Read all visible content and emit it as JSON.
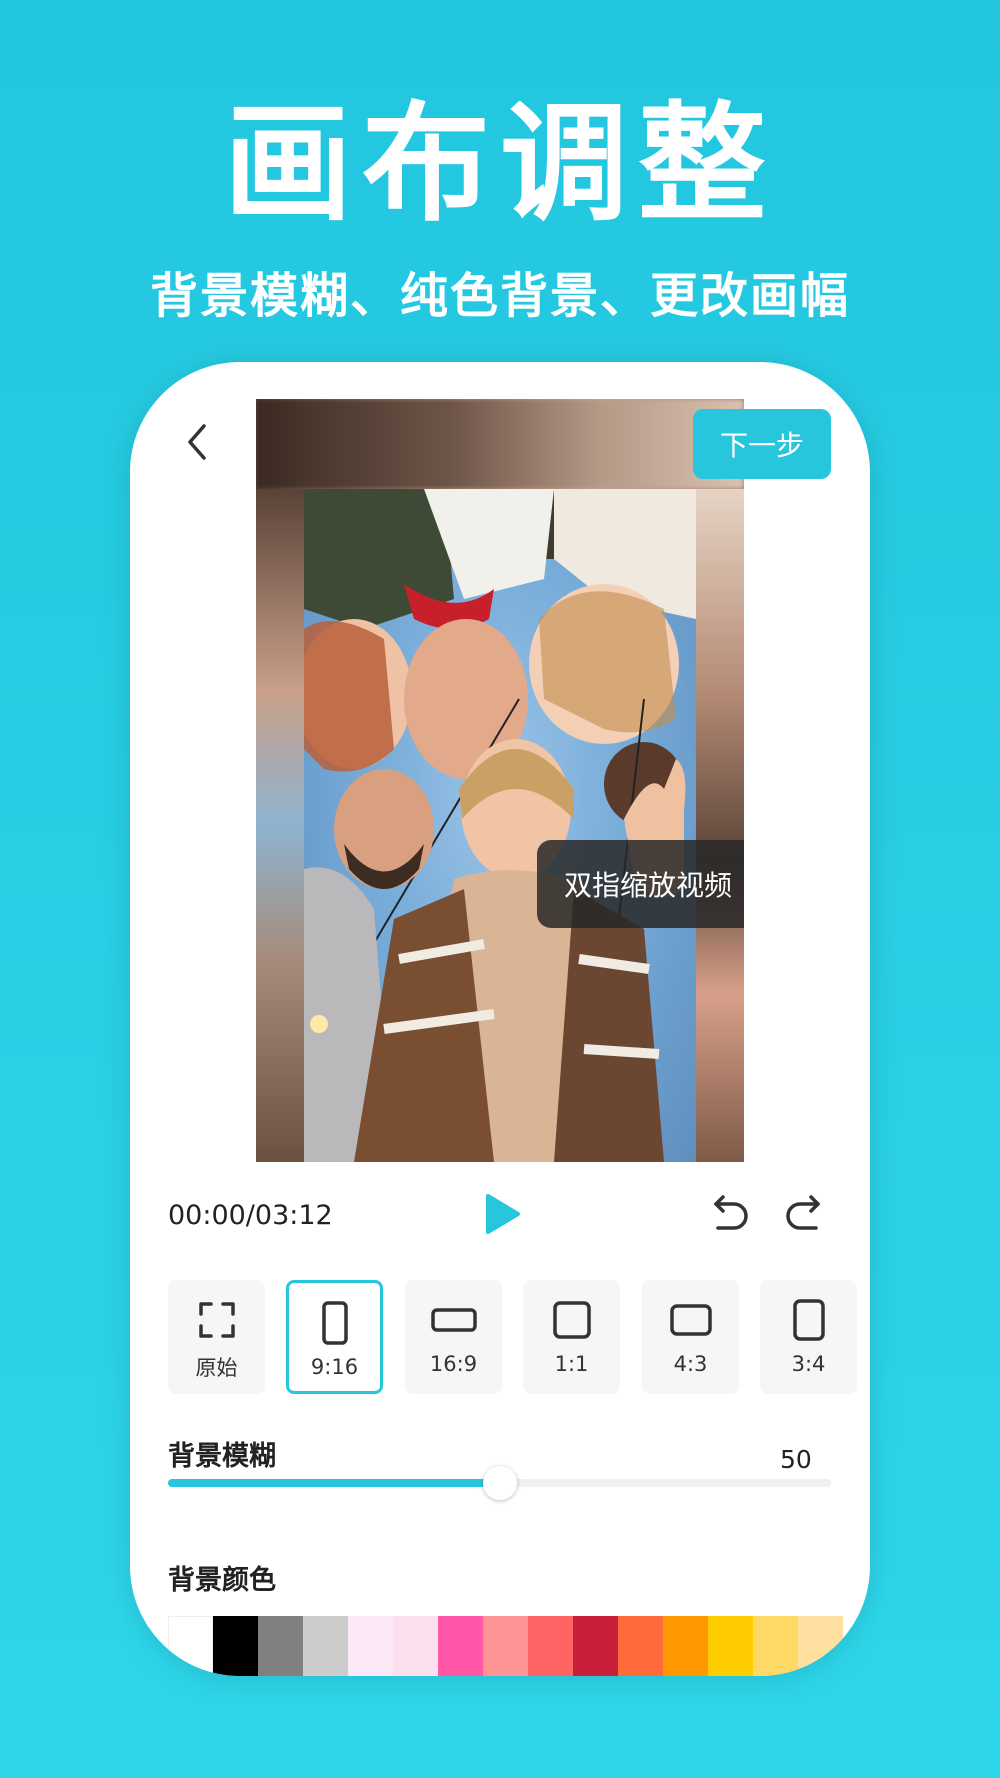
{
  "hero": {
    "title": "画布调整",
    "subtitle": "背景模糊、纯色背景、更改画幅"
  },
  "toolbar": {
    "next_label": "下一步"
  },
  "preview": {
    "hint": "双指缩放视频"
  },
  "playback": {
    "timecode": "00:00/03:12"
  },
  "ratios": [
    {
      "label": "原始",
      "icon": "fullscreen-icon"
    },
    {
      "label": "9:16",
      "icon": "portrait-rect-icon",
      "selected": true
    },
    {
      "label": "16:9",
      "icon": "wide-rect-icon"
    },
    {
      "label": "1:1",
      "icon": "square-icon"
    },
    {
      "label": "4:3",
      "icon": "landscape-rect-icon"
    },
    {
      "label": "3:4",
      "icon": "portrait-rect-icon"
    }
  ],
  "blur": {
    "label": "背景模糊",
    "value": "50",
    "level_fraction": 0.5
  },
  "background_color": {
    "label": "背景颜色",
    "swatches": [
      "#ffffff",
      "#000000",
      "#808080",
      "#cccccc",
      "#fbe8f6",
      "#fde0ef",
      "#ff56a8",
      "#ff9494",
      "#ff6464",
      "#c8203a",
      "#ff6a3a",
      "#ff9800",
      "#ffcc00",
      "#ffd966",
      "#ffe0a0"
    ]
  },
  "colors": {
    "accent": "#27c6dd",
    "background": "#22c6df"
  }
}
